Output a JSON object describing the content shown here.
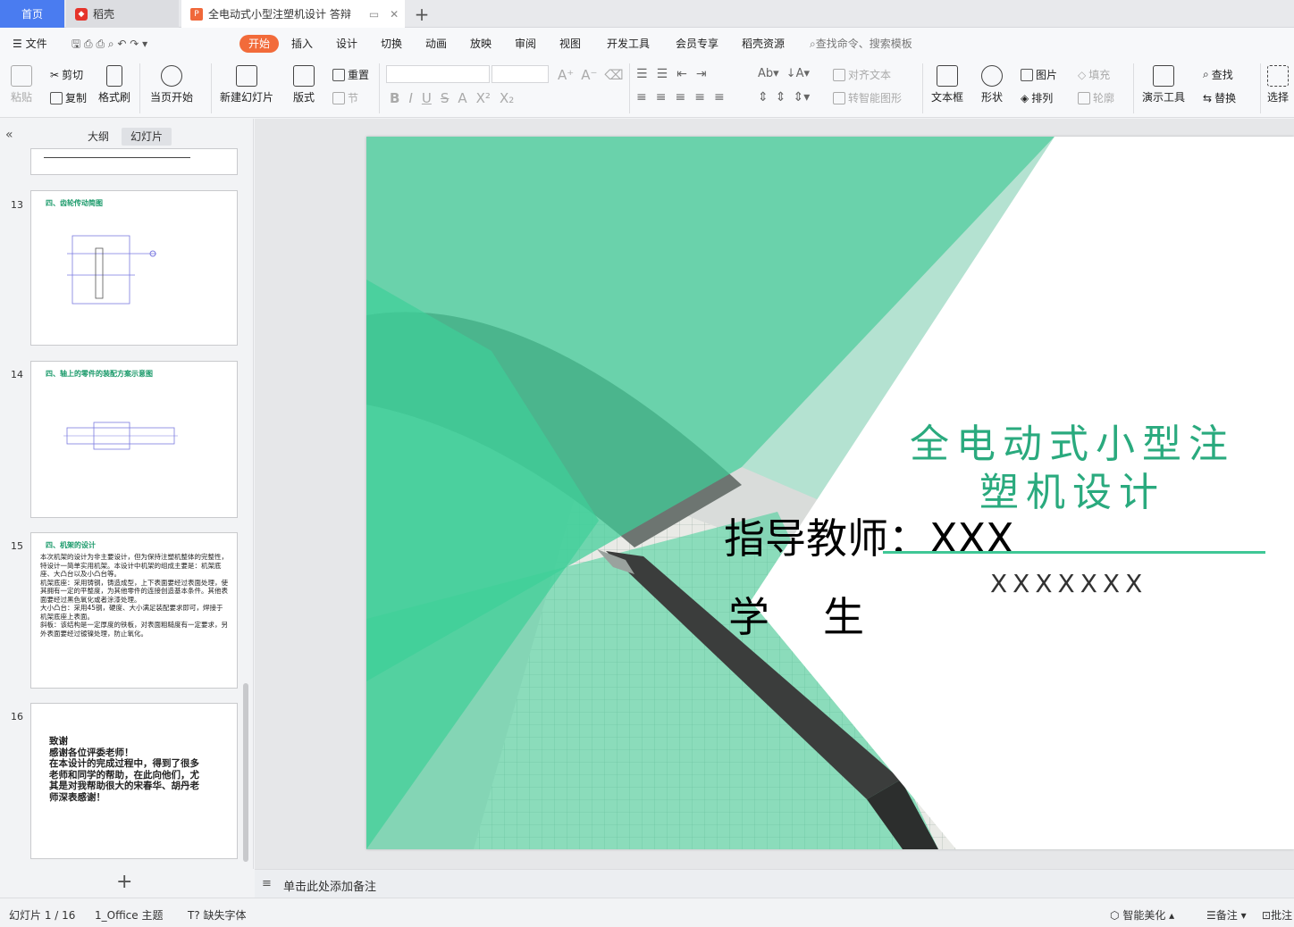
{
  "tabs": {
    "home": "首页",
    "daoke": "稻壳",
    "doc": "全电动式小型注塑机设计 答辩"
  },
  "menu": {
    "file": "文件",
    "items": [
      "开始",
      "插入",
      "设计",
      "切换",
      "动画",
      "放映",
      "审阅",
      "视图",
      "开发工具",
      "会员专享",
      "稻壳资源"
    ],
    "search": "查找命令、搜索模板"
  },
  "ribbon": {
    "paste": "粘贴",
    "cut": "剪切",
    "copy": "复制",
    "format_painter": "格式刷",
    "from_current": "当页开始",
    "new_slide": "新建幻灯片",
    "layout": "版式",
    "reset": "重置",
    "section": "节",
    "align_text": "对齐文本",
    "smart_shape": "转智能图形",
    "textbox": "文本框",
    "shape": "形状",
    "picture": "图片",
    "arrange": "排列",
    "fill": "填充",
    "outline": "轮廓",
    "present_tools": "演示工具",
    "find": "查找",
    "replace": "替换",
    "select": "选择"
  },
  "sidebar": {
    "tab_outline": "大纲",
    "tab_slides": "幻灯片"
  },
  "thumbs": [
    {
      "num": "13",
      "title": "四、齿轮传动简图"
    },
    {
      "num": "14",
      "title": "四、轴上的零件的装配方案示意图"
    },
    {
      "num": "15",
      "title": "四、机架的设计",
      "body": "本次机架的设计为非主要设计，但为保持注塑机整体的完整性，特设计一简单实用机架。本设计中机架的组成主要是：机架底座、大凸台以及小凸台等。\n机架底座：采用铸钢，铸造成型，上下表面要经过表面处理，使其拥有一定的平整度，为其他零件的连接创造基本条件。其他表面要经过黑色氧化或者涂漆处理。\n大小凸台：采用45钢，硬度、大小满足装配要求即可，焊接于机架底座上表面。\n斜板：该结构是一定厚度的铁板，对表面粗糙度有一定要求，另外表面要经过镀镍处理，防止氧化。"
    },
    {
      "num": "16",
      "body": "致谢\n感谢各位评委老师！\n在本设计的完成过程中，得到了很多老师和同学的帮助，在此向他们，尤其是对我帮助很大的宋春华、胡丹老师深表感谢！"
    }
  ],
  "slide": {
    "title": "全电动式小型注塑机设计",
    "teacher": "指导教师：XXX",
    "student": "学生",
    "code": "XXXXXXX"
  },
  "notes": "单击此处添加备注",
  "status": {
    "slide": "幻灯片 1 / 16",
    "theme": "1_Office 主题",
    "font": "缺失字体",
    "beautify": "智能美化",
    "notes": "备注",
    "comment": "批注"
  },
  "colors": {
    "accent": "#f26b3a",
    "green": "#2aaa7e",
    "tab_blue": "#4a7cf0"
  }
}
